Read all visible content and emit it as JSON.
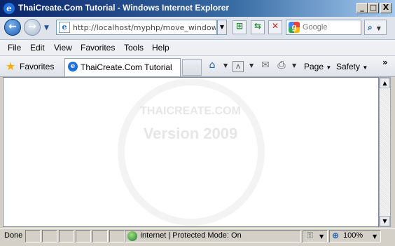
{
  "window": {
    "title": "ThaiCreate.Com Tutorial - Windows Internet Explorer",
    "min_symbol": "_",
    "max_symbol": "□",
    "close_symbol": "X"
  },
  "address_bar": {
    "url": "http://localhost/myphp/move_window.htm",
    "back_symbol": "←",
    "forward_symbol": "→"
  },
  "search": {
    "placeholder": "Google",
    "logo_letter": "g"
  },
  "menu": {
    "items": [
      "File",
      "Edit",
      "View",
      "Favorites",
      "Tools",
      "Help"
    ]
  },
  "favorites_bar": {
    "favorites_label": "Favorites"
  },
  "tab": {
    "label": "ThaiCreate.Com Tutorial",
    "icon_letter": "e"
  },
  "command_bar": {
    "page_label": "Page",
    "safety_label": "Safety",
    "chevron": "»"
  },
  "watermark": {
    "line1": "THAICREATE.COM",
    "line2": "Version 2009"
  },
  "status_bar": {
    "status": "Done",
    "zone": "Internet | Protected Mode: On",
    "zoom": "100%"
  },
  "icons": {
    "ie": "ie-logo-icon",
    "back": "back-arrow-icon",
    "forward": "forward-arrow-icon",
    "compat": "compatibility-view-icon",
    "refresh": "refresh-icon",
    "stop": "stop-icon",
    "search": "magnifier-icon",
    "star": "star-icon",
    "home": "home-icon",
    "feeds": "rss-feed-icon",
    "mail": "mail-icon",
    "print": "printer-icon",
    "globe": "globe-icon",
    "lock": "lock-icon",
    "zoom": "zoom-icon"
  }
}
